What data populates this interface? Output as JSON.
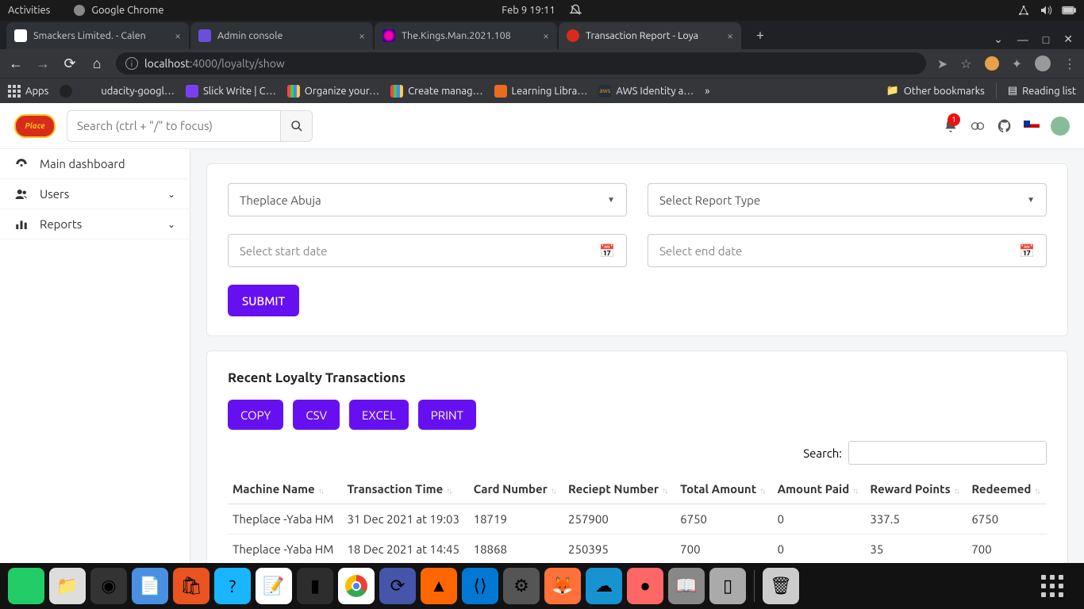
{
  "ubuntu_top": {
    "activities": "Activities",
    "app_name": "Google Chrome",
    "datetime": "Feb 9  19:11"
  },
  "chrome": {
    "tabs": [
      {
        "label": "Smackers Limited. - Calen",
        "active": false
      },
      {
        "label": "Admin console",
        "active": false
      },
      {
        "label": "The.Kings.Man.2021.108",
        "active": false
      },
      {
        "label": "Transaction Report - Loya",
        "active": true
      }
    ],
    "url_host": "localhost",
    "url_path": ":4000/loyalty/show",
    "bookmarks": {
      "apps": "Apps",
      "items": [
        "udacity-googl…",
        "Slick Write | C…",
        "Organize your…",
        "Create manag…",
        "Learning Libra…",
        "AWS Identity a…"
      ],
      "more": "»",
      "other": "Other bookmarks",
      "reading": "Reading list"
    }
  },
  "app": {
    "search_placeholder": "Search (ctrl + \"/\" to focus)",
    "notification_count": "1",
    "sidebar": [
      {
        "label": "Main dashboard",
        "icon": "dashboard",
        "chev": false
      },
      {
        "label": "Users",
        "icon": "users",
        "chev": true
      },
      {
        "label": "Reports",
        "icon": "chart",
        "chev": true
      }
    ],
    "form": {
      "location": "Theplace Abuja",
      "report_type": "Select Report Type",
      "start_placeholder": "Select start date",
      "end_placeholder": "Select end date",
      "submit": "SUBMIT"
    },
    "table": {
      "title": "Recent Loyalty Transactions",
      "export": [
        "COPY",
        "CSV",
        "EXCEL",
        "PRINT"
      ],
      "search_label": "Search:",
      "columns": [
        "Machine Name",
        "Transaction Time",
        "Card Number",
        "Reciept Number",
        "Total Amount",
        "Amount Paid",
        "Reward Points",
        "Redeemed"
      ],
      "rows": [
        {
          "machine": "Theplace -Yaba HM",
          "time": "31 Dec 2021 at 19:03",
          "card": "18719",
          "receipt": "257900",
          "total": "6750",
          "paid": "0",
          "points": "337.5",
          "redeemed": "6750"
        },
        {
          "machine": "Theplace -Yaba HM",
          "time": "18 Dec 2021 at 14:45",
          "card": "18868",
          "receipt": "250395",
          "total": "700",
          "paid": "0",
          "points": "35",
          "redeemed": "700"
        }
      ]
    }
  }
}
